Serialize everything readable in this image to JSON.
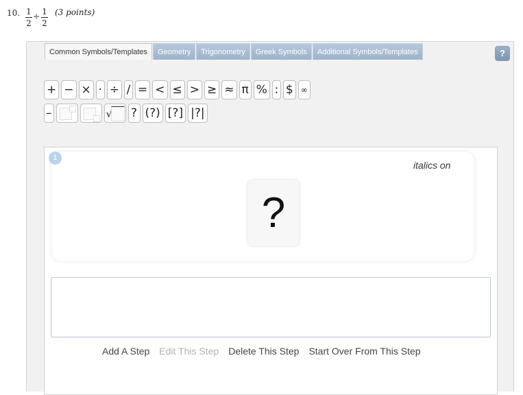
{
  "question": {
    "number": "10.",
    "frac1_num": "1",
    "frac1_den": "2",
    "op": "÷",
    "frac2_num": "1",
    "frac2_den": "2",
    "points": "(3 points)"
  },
  "tabs": [
    "Common Symbols/Templates",
    "Geometry",
    "Trigonometry",
    "Greek Symbols",
    "Additional Symbols/Templates"
  ],
  "help_label": "?",
  "symbols_row1": [
    "+",
    "−",
    "×",
    "·",
    "÷",
    "/",
    "=",
    "<",
    "≤",
    ">",
    "≥",
    "≈",
    "π",
    "%",
    ":",
    "$",
    "∞"
  ],
  "symbols_row2": {
    "minus_bar": "–",
    "sqrt_sign": "√",
    "q": "?",
    "paren_q": "(?)",
    "bracket_q": "[?]",
    "abs_q": "|?|"
  },
  "step": {
    "number": "1",
    "italics": "italics on",
    "placeholder_glyph": "?"
  },
  "actions": {
    "add": "Add A Step",
    "edit": "Edit This Step",
    "delete": "Delete This Step",
    "start_over": "Start Over From This Step"
  },
  "colors": {
    "tab_inactive": "#9db2cb",
    "step_badge": "#b9d3ee",
    "disabled_text": "#b2b2b2"
  }
}
